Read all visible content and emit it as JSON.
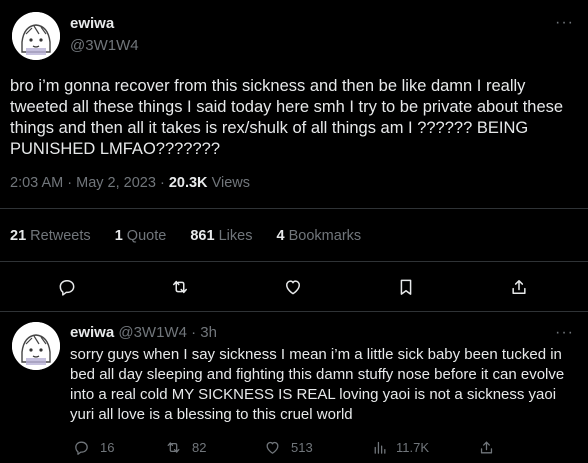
{
  "main_tweet": {
    "author_name": "ewiwa",
    "author_handle": "@3W1W4",
    "more_label": "···",
    "text": "bro i’m gonna recover from this sickness and then be like damn I really tweeted all these things I said today here smh I try to be private about these things and then all it takes is rex/shulk of all things am I ?????? BEING PUNISHED LMFAO???????",
    "time": "2:03 AM",
    "separator": "·",
    "date": "May 2, 2023",
    "views_count": "20.3K",
    "views_label": "Views",
    "stats": {
      "retweets_count": "21",
      "retweets_label": "Retweets",
      "quotes_count": "1",
      "quotes_label": "Quote",
      "likes_count": "861",
      "likes_label": "Likes",
      "bookmarks_count": "4",
      "bookmarks_label": "Bookmarks"
    }
  },
  "reply_tweet": {
    "author_name": "ewiwa",
    "author_handle": "@3W1W4",
    "separator": "·",
    "age": "3h",
    "more_label": "···",
    "text": "sorry guys when I say sickness I mean i’m a little sick baby been tucked in bed all day sleeping and fighting this damn stuffy nose before it can evolve into a real cold MY SICKNESS IS REAL loving yaoi is not a sickness yaoi yuri all love is a blessing to this cruel world",
    "replies": "16",
    "retweets": "82",
    "likes": "513",
    "views": "11.7K"
  },
  "icons": {
    "reply": "comment-bubble-icon",
    "retweet": "retweet-arrows-icon",
    "like": "heart-icon",
    "bookmark": "bookmark-icon",
    "share": "share-upload-icon",
    "views": "bar-chart-icon"
  },
  "colors": {
    "background": "#000000",
    "text": "#e7e9ea",
    "muted": "#71767b",
    "divider": "#2f3336"
  }
}
